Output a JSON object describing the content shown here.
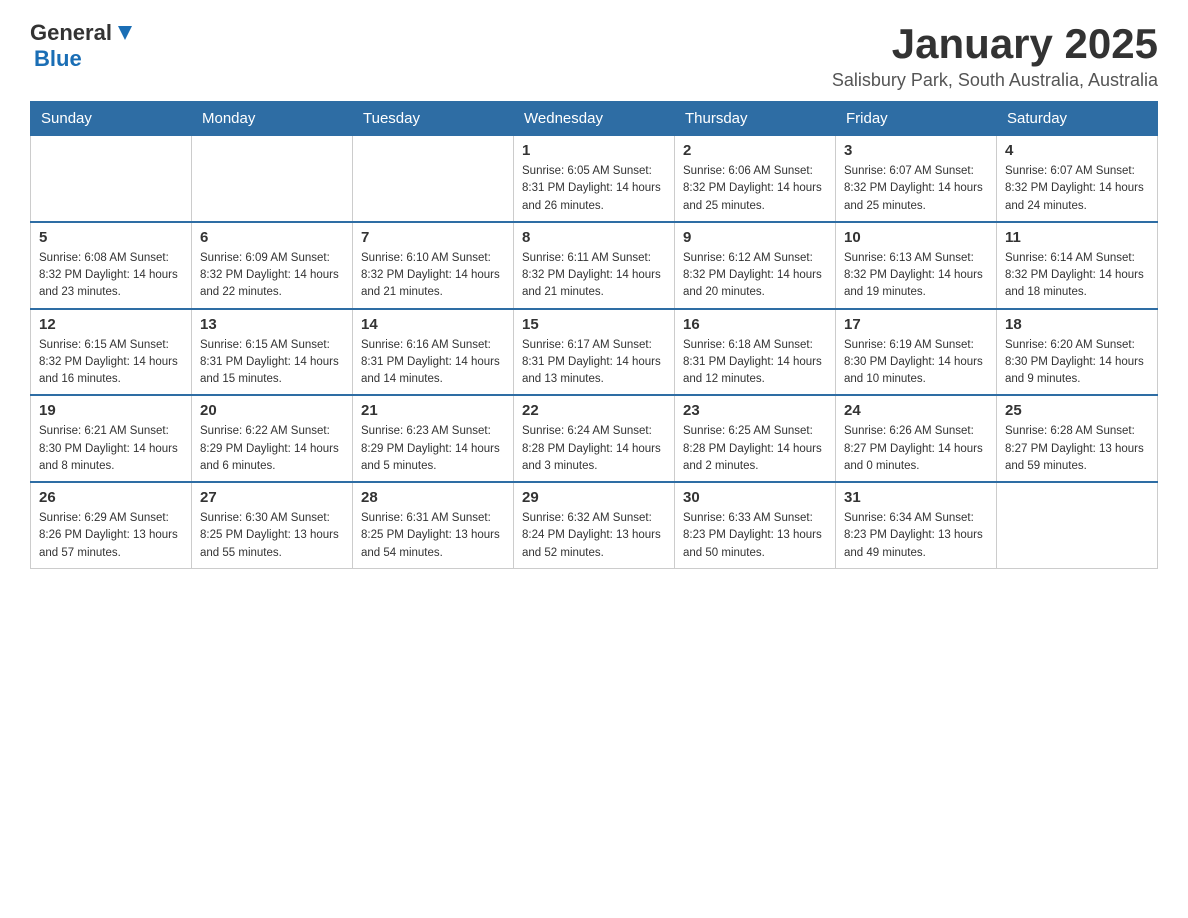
{
  "logo": {
    "general": "General",
    "blue": "Blue"
  },
  "title": "January 2025",
  "subtitle": "Salisbury Park, South Australia, Australia",
  "headers": [
    "Sunday",
    "Monday",
    "Tuesday",
    "Wednesday",
    "Thursday",
    "Friday",
    "Saturday"
  ],
  "weeks": [
    [
      {
        "day": "",
        "info": ""
      },
      {
        "day": "",
        "info": ""
      },
      {
        "day": "",
        "info": ""
      },
      {
        "day": "1",
        "info": "Sunrise: 6:05 AM\nSunset: 8:31 PM\nDaylight: 14 hours\nand 26 minutes."
      },
      {
        "day": "2",
        "info": "Sunrise: 6:06 AM\nSunset: 8:32 PM\nDaylight: 14 hours\nand 25 minutes."
      },
      {
        "day": "3",
        "info": "Sunrise: 6:07 AM\nSunset: 8:32 PM\nDaylight: 14 hours\nand 25 minutes."
      },
      {
        "day": "4",
        "info": "Sunrise: 6:07 AM\nSunset: 8:32 PM\nDaylight: 14 hours\nand 24 minutes."
      }
    ],
    [
      {
        "day": "5",
        "info": "Sunrise: 6:08 AM\nSunset: 8:32 PM\nDaylight: 14 hours\nand 23 minutes."
      },
      {
        "day": "6",
        "info": "Sunrise: 6:09 AM\nSunset: 8:32 PM\nDaylight: 14 hours\nand 22 minutes."
      },
      {
        "day": "7",
        "info": "Sunrise: 6:10 AM\nSunset: 8:32 PM\nDaylight: 14 hours\nand 21 minutes."
      },
      {
        "day": "8",
        "info": "Sunrise: 6:11 AM\nSunset: 8:32 PM\nDaylight: 14 hours\nand 21 minutes."
      },
      {
        "day": "9",
        "info": "Sunrise: 6:12 AM\nSunset: 8:32 PM\nDaylight: 14 hours\nand 20 minutes."
      },
      {
        "day": "10",
        "info": "Sunrise: 6:13 AM\nSunset: 8:32 PM\nDaylight: 14 hours\nand 19 minutes."
      },
      {
        "day": "11",
        "info": "Sunrise: 6:14 AM\nSunset: 8:32 PM\nDaylight: 14 hours\nand 18 minutes."
      }
    ],
    [
      {
        "day": "12",
        "info": "Sunrise: 6:15 AM\nSunset: 8:32 PM\nDaylight: 14 hours\nand 16 minutes."
      },
      {
        "day": "13",
        "info": "Sunrise: 6:15 AM\nSunset: 8:31 PM\nDaylight: 14 hours\nand 15 minutes."
      },
      {
        "day": "14",
        "info": "Sunrise: 6:16 AM\nSunset: 8:31 PM\nDaylight: 14 hours\nand 14 minutes."
      },
      {
        "day": "15",
        "info": "Sunrise: 6:17 AM\nSunset: 8:31 PM\nDaylight: 14 hours\nand 13 minutes."
      },
      {
        "day": "16",
        "info": "Sunrise: 6:18 AM\nSunset: 8:31 PM\nDaylight: 14 hours\nand 12 minutes."
      },
      {
        "day": "17",
        "info": "Sunrise: 6:19 AM\nSunset: 8:30 PM\nDaylight: 14 hours\nand 10 minutes."
      },
      {
        "day": "18",
        "info": "Sunrise: 6:20 AM\nSunset: 8:30 PM\nDaylight: 14 hours\nand 9 minutes."
      }
    ],
    [
      {
        "day": "19",
        "info": "Sunrise: 6:21 AM\nSunset: 8:30 PM\nDaylight: 14 hours\nand 8 minutes."
      },
      {
        "day": "20",
        "info": "Sunrise: 6:22 AM\nSunset: 8:29 PM\nDaylight: 14 hours\nand 6 minutes."
      },
      {
        "day": "21",
        "info": "Sunrise: 6:23 AM\nSunset: 8:29 PM\nDaylight: 14 hours\nand 5 minutes."
      },
      {
        "day": "22",
        "info": "Sunrise: 6:24 AM\nSunset: 8:28 PM\nDaylight: 14 hours\nand 3 minutes."
      },
      {
        "day": "23",
        "info": "Sunrise: 6:25 AM\nSunset: 8:28 PM\nDaylight: 14 hours\nand 2 minutes."
      },
      {
        "day": "24",
        "info": "Sunrise: 6:26 AM\nSunset: 8:27 PM\nDaylight: 14 hours\nand 0 minutes."
      },
      {
        "day": "25",
        "info": "Sunrise: 6:28 AM\nSunset: 8:27 PM\nDaylight: 13 hours\nand 59 minutes."
      }
    ],
    [
      {
        "day": "26",
        "info": "Sunrise: 6:29 AM\nSunset: 8:26 PM\nDaylight: 13 hours\nand 57 minutes."
      },
      {
        "day": "27",
        "info": "Sunrise: 6:30 AM\nSunset: 8:25 PM\nDaylight: 13 hours\nand 55 minutes."
      },
      {
        "day": "28",
        "info": "Sunrise: 6:31 AM\nSunset: 8:25 PM\nDaylight: 13 hours\nand 54 minutes."
      },
      {
        "day": "29",
        "info": "Sunrise: 6:32 AM\nSunset: 8:24 PM\nDaylight: 13 hours\nand 52 minutes."
      },
      {
        "day": "30",
        "info": "Sunrise: 6:33 AM\nSunset: 8:23 PM\nDaylight: 13 hours\nand 50 minutes."
      },
      {
        "day": "31",
        "info": "Sunrise: 6:34 AM\nSunset: 8:23 PM\nDaylight: 13 hours\nand 49 minutes."
      },
      {
        "day": "",
        "info": ""
      }
    ]
  ]
}
